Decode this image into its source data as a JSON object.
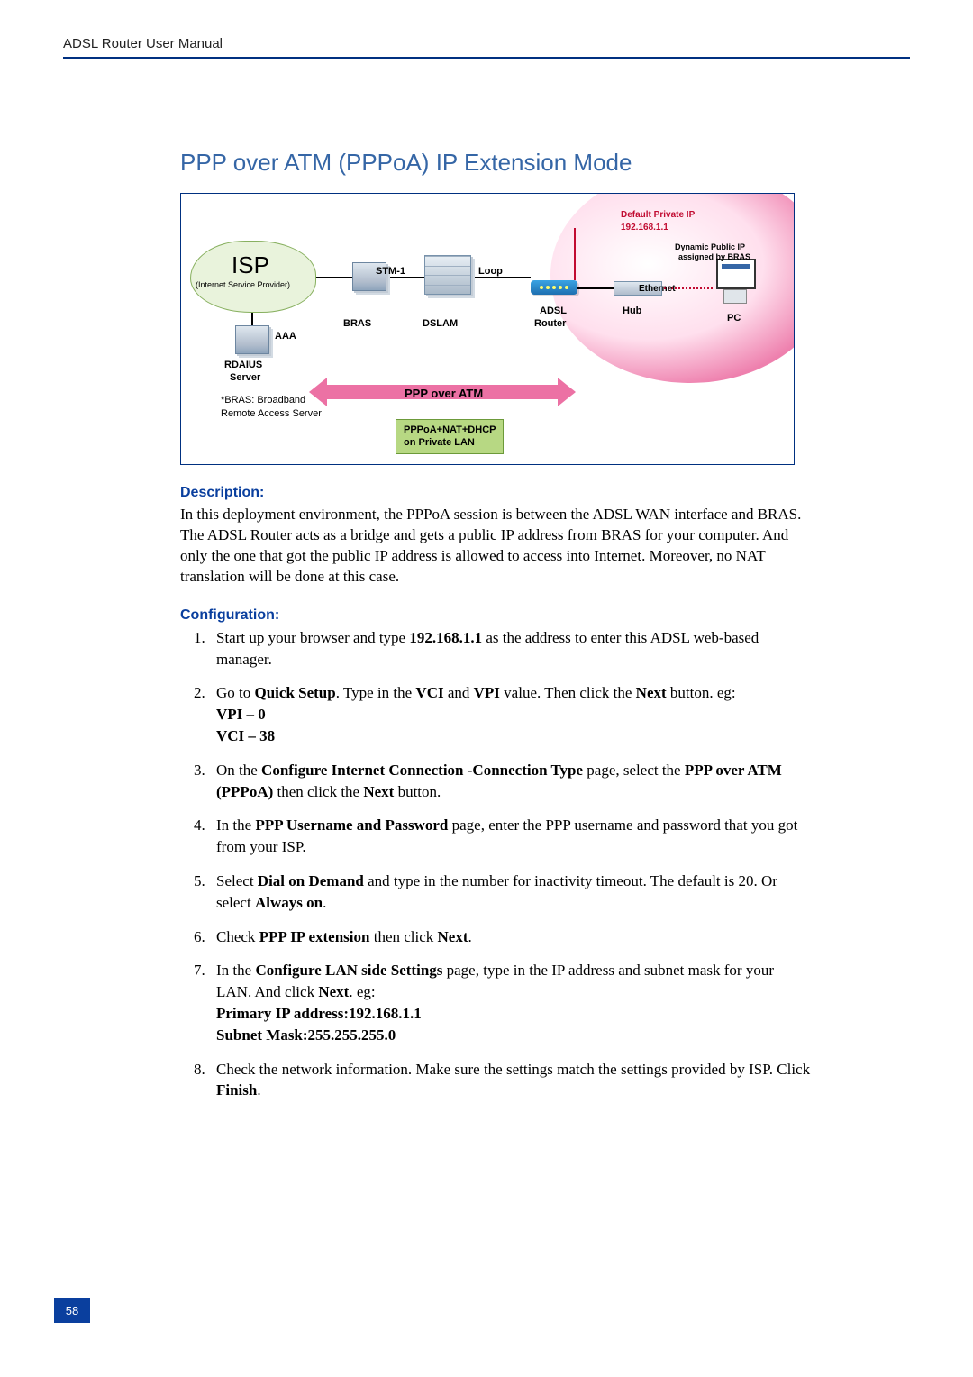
{
  "header": {
    "title": "ADSL Router User Manual"
  },
  "title": "PPP over ATM (PPPoA) IP Extension Mode",
  "diagram": {
    "isp": "ISP",
    "isp_sub": "(Internet Service Provider)",
    "aaa": "AAA",
    "rdaius_server_l1": "RDAIUS",
    "rdaius_server_l2": "Server",
    "note_l1": "*BRAS: Broadband",
    "note_l2": "Remote Access Server",
    "stm1": "STM-1",
    "loop": "Loop",
    "bras": "BRAS",
    "dslam": "DSLAM",
    "adsl_l1": "ADSL",
    "adsl_l2": "Router",
    "hub": "Hub",
    "pc": "PC",
    "ethernet": "Ethernet",
    "def_ip_l1": "Default Private IP",
    "def_ip_l2": "192.168.1.1",
    "dyn_ip_l1": "Dynamic Public IP",
    "dyn_ip_l2": "assigned by BRAS",
    "ppp_over_atm": "PPP over ATM",
    "badge_l1": "PPPoA+NAT+DHCP",
    "badge_l2": "on Private LAN"
  },
  "description": {
    "heading": "Description:",
    "text": "In this deployment environment, the PPPoA session is between the ADSL WAN interface and BRAS. The ADSL Router acts as a bridge and gets a public IP address from BRAS for your computer. And only the one that got the public IP address is allowed to access into Internet. Moreover, no NAT translation will be done at this case."
  },
  "configuration": {
    "heading": "Configuration:",
    "steps": {
      "s1a": "Start up your browser and type ",
      "s1b": "192.168.1.1",
      "s1c": " as the address to enter this ADSL web-based manager.",
      "s2a": "Go to ",
      "s2b": "Quick Setup",
      "s2c": ". Type in the ",
      "s2d": "VCI",
      "s2e": " and ",
      "s2f": "VPI",
      "s2g": " value. Then click the ",
      "s2h": "Next",
      "s2i": " button.  eg:",
      "s2j": "VPI – 0",
      "s2k": "VCI – 38",
      "s3a": "On the ",
      "s3b": "Configure Internet Connection -Connection Type",
      "s3c": " page, select the ",
      "s3d": "PPP over ATM (PPPoA)",
      "s3e": " then click the ",
      "s3f": "Next",
      "s3g": " button.",
      "s4a": "In the ",
      "s4b": "PPP Username and Password",
      "s4c": " page, enter the PPP username and password that you got from your ISP.",
      "s5a": "Select ",
      "s5b": "Dial on Demand",
      "s5c": " and type in the number for inactivity timeout. The default is 20. Or select ",
      "s5d": "Always on",
      "s5e": ".",
      "s6a": "Check ",
      "s6b": "PPP IP extension",
      "s6c": " then click ",
      "s6d": "Next",
      "s6e": ".",
      "s7a": "In the ",
      "s7b": "Configure LAN side Settings",
      "s7c": " page, type in the IP address and subnet mask for your LAN. And click ",
      "s7d": "Next",
      "s7e": ". eg:",
      "s7f": "Primary IP address:192.168.1.1",
      "s7g": "Subnet Mask:255.255.255.0",
      "s8a": "Check the network information. Make sure the settings match the settings provided by ISP. Click ",
      "s8b": "Finish",
      "s8c": "."
    }
  },
  "page_number": "58"
}
